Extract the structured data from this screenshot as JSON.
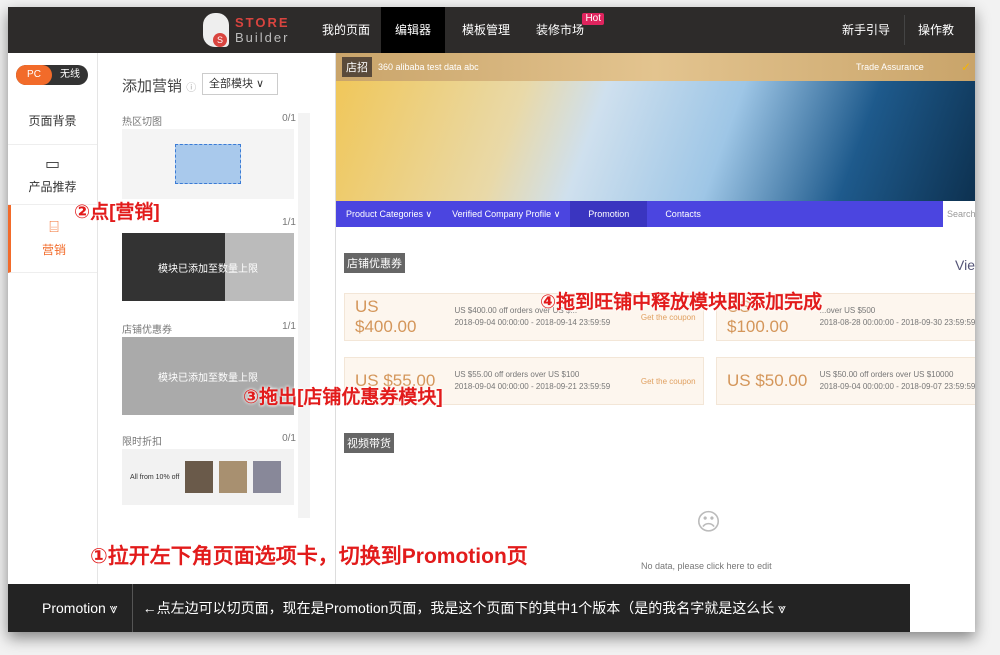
{
  "topbar": {
    "logo": [
      "STORE",
      "Builder"
    ],
    "nav": [
      "我的页面",
      "编辑器",
      "模板管理",
      "装修市场"
    ],
    "hot": "Hot",
    "right": [
      "新手引导",
      "操作教程"
    ]
  },
  "left": {
    "toggle": [
      "PC",
      "无线"
    ],
    "items": [
      "页面背景",
      "产品推荐",
      "营销"
    ]
  },
  "panel": {
    "title": "添加营销",
    "filter": "全部模块",
    "sections": [
      {
        "name": "热区切图",
        "count": "0/1"
      },
      {
        "name": "",
        "count": "1/1",
        "overlay": "模块已添加至数量上限"
      },
      {
        "name": "店铺优惠券",
        "count": "1/1",
        "overlay": "模块已添加至数量上限"
      },
      {
        "name": "限时折扣",
        "count": "0/1",
        "preview": "All from 10% off"
      }
    ]
  },
  "canvas": {
    "shop_tag": "店招",
    "shop_name": "360 alibaba test data abc",
    "trade": "Trade Assurance",
    "menu": [
      "Product Categories ∨",
      "Verified Company Profile ∨",
      "Promotion",
      "Contacts"
    ],
    "search": "Search",
    "coupon_tag": "店铺优惠券",
    "view": "Vie",
    "coupons": [
      {
        "amount": "US $400.00",
        "desc": "US $400.00 off orders over US $...",
        "date": "2018-09-04 00:00:00 - 2018-09-14 23:59:59",
        "get": "Get the coupon"
      },
      {
        "amount": "US $100.00",
        "desc": "...over US $500",
        "date": "2018-08-28 00:00:00 - 2018-09-30 23:59:59",
        "get": ""
      },
      {
        "amount": "US $55.00",
        "desc": "US $55.00 off orders over US $100",
        "date": "2018-09-04 00:00:00 - 2018-09-21 23:59:59",
        "get": "Get the coupon"
      },
      {
        "amount": "US $50.00",
        "desc": "US $50.00 off orders over US $10000",
        "date": "2018-09-04 00:00:00 - 2018-09-07 23:59:59",
        "get": ""
      }
    ],
    "video_tag": "视频带货",
    "nodata": "No data, please click here to edit"
  },
  "annotations": [
    "②点[营销]",
    "③拖出[店铺优惠券模块]",
    "④拖到旺铺中释放模块即添加完成",
    "①拉开左下角页面选项卡，切换到Promotion页"
  ],
  "bottom": {
    "page": "Promotion",
    "version": "←点左边可以切页面，现在是Promotion页面，我是这个页面下的其中1个版本（是的我名字就是这么长"
  }
}
